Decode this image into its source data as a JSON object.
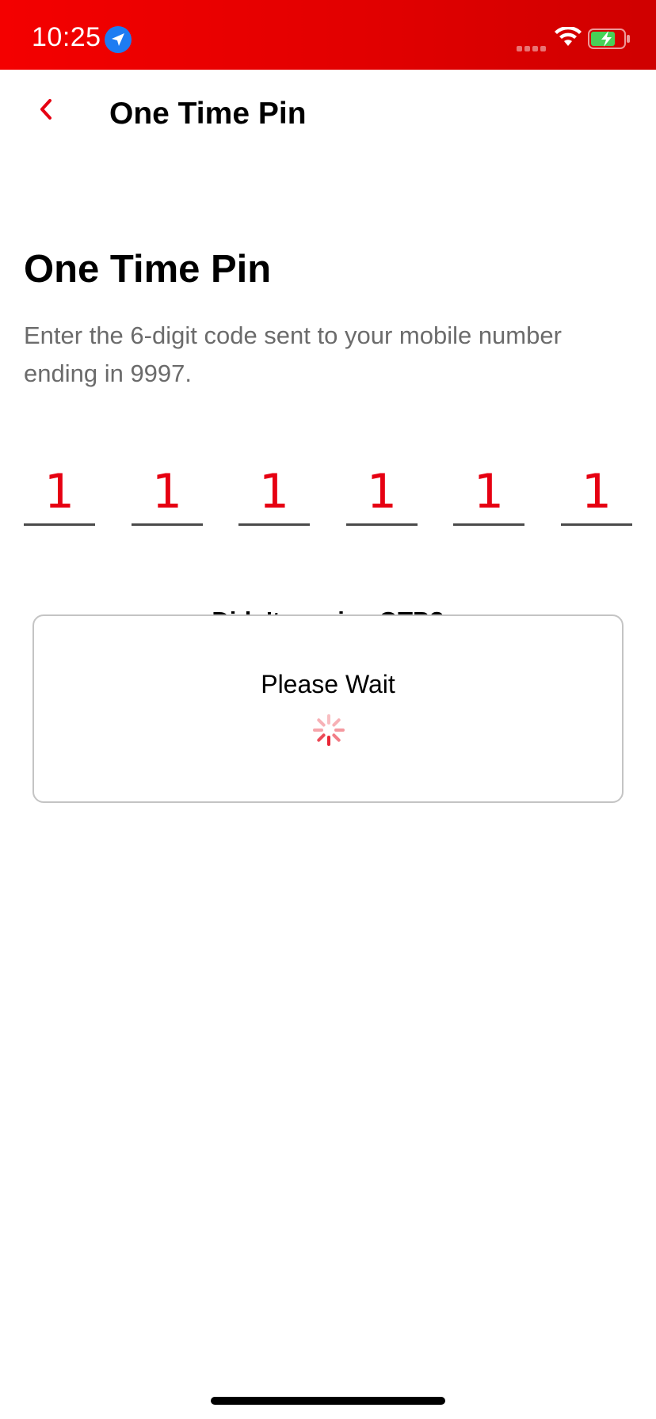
{
  "status_bar": {
    "time": "10:25",
    "icons": [
      "location-icon",
      "signal-icon",
      "wifi-icon",
      "battery-charging-icon"
    ],
    "background_color": "#e00000"
  },
  "nav": {
    "back_icon": "chevron-left-icon",
    "title": "One Time Pin"
  },
  "main": {
    "heading": "One Time Pin",
    "description": "Enter the 6-digit code sent to your mobile number ending in 9997.",
    "otp_digits": [
      "1",
      "1",
      "1",
      "1",
      "1",
      "1"
    ],
    "resend_prompt": "Didn't receive OTP?"
  },
  "dialog": {
    "message": "Please Wait",
    "spinner_icon": "loading-spinner-icon"
  },
  "colors": {
    "accent": "#e60012",
    "text_secondary": "#6b6b6b"
  }
}
